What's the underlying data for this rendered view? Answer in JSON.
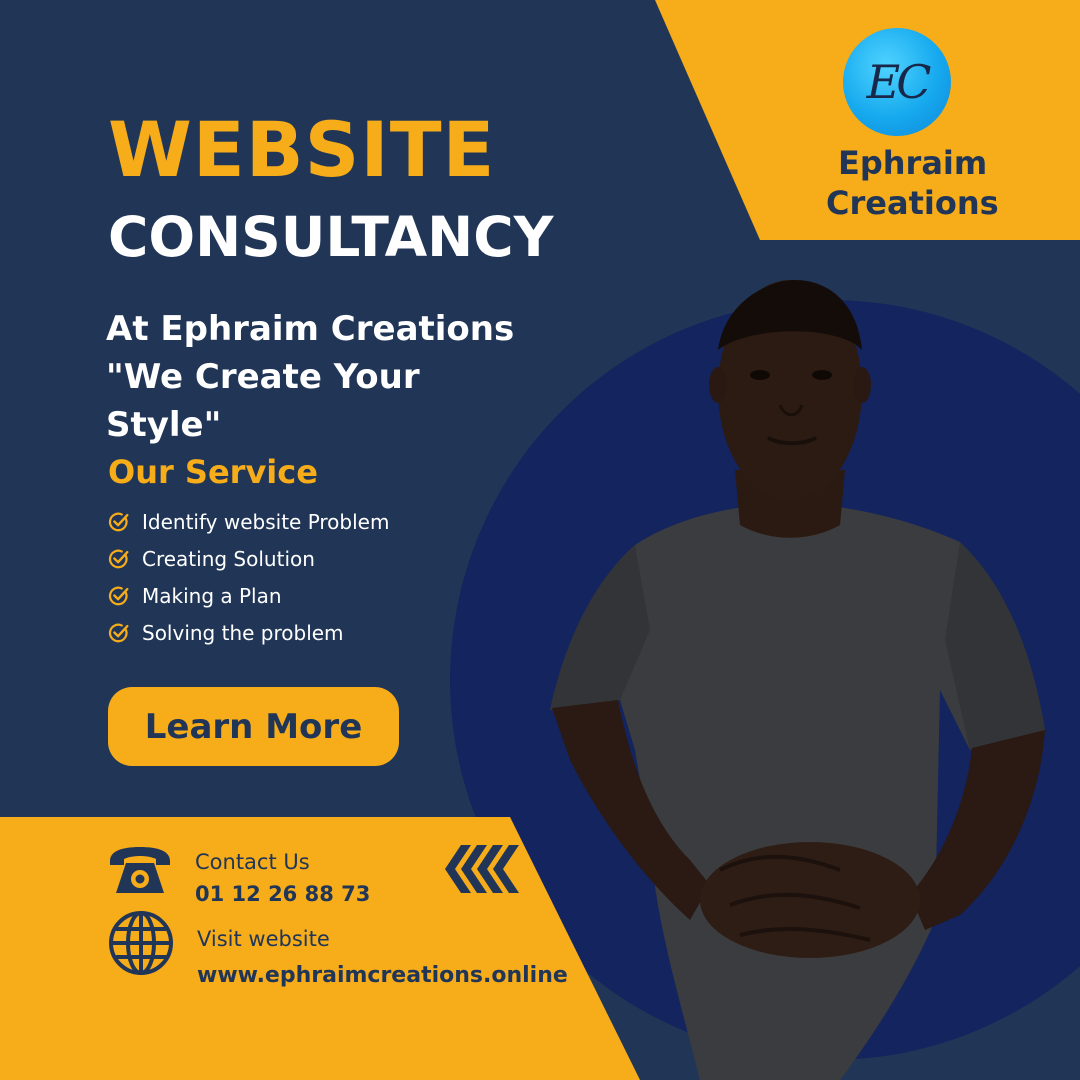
{
  "colors": {
    "navy": "#213657",
    "deep_blue": "#13245E",
    "orange": "#F7AC19",
    "white": "#FFFFFF"
  },
  "headline": {
    "line1": "WEBSITE",
    "line2": "CONSULTANCY"
  },
  "tagline": "At Ephraim Creations \"We Create Your Style\"",
  "services": {
    "title": "Our Service",
    "icon": "check-circle-icon",
    "items": [
      "Identify website Problem",
      "Creating Solution",
      "Making a Plan",
      "Solving the problem"
    ]
  },
  "cta": {
    "label": "Learn More"
  },
  "contact": {
    "icon": "telephone-icon",
    "label": "Contact Us",
    "phone": "01 12 26 88 73"
  },
  "website": {
    "icon": "globe-icon",
    "label": "Visit website",
    "url": "www.ephraimcreations.online"
  },
  "decor": {
    "arrows_icon": "chevrons-left-icon"
  },
  "brand": {
    "logo_text": "EC",
    "name_line1": "Ephraim",
    "name_line2": "Creations"
  }
}
